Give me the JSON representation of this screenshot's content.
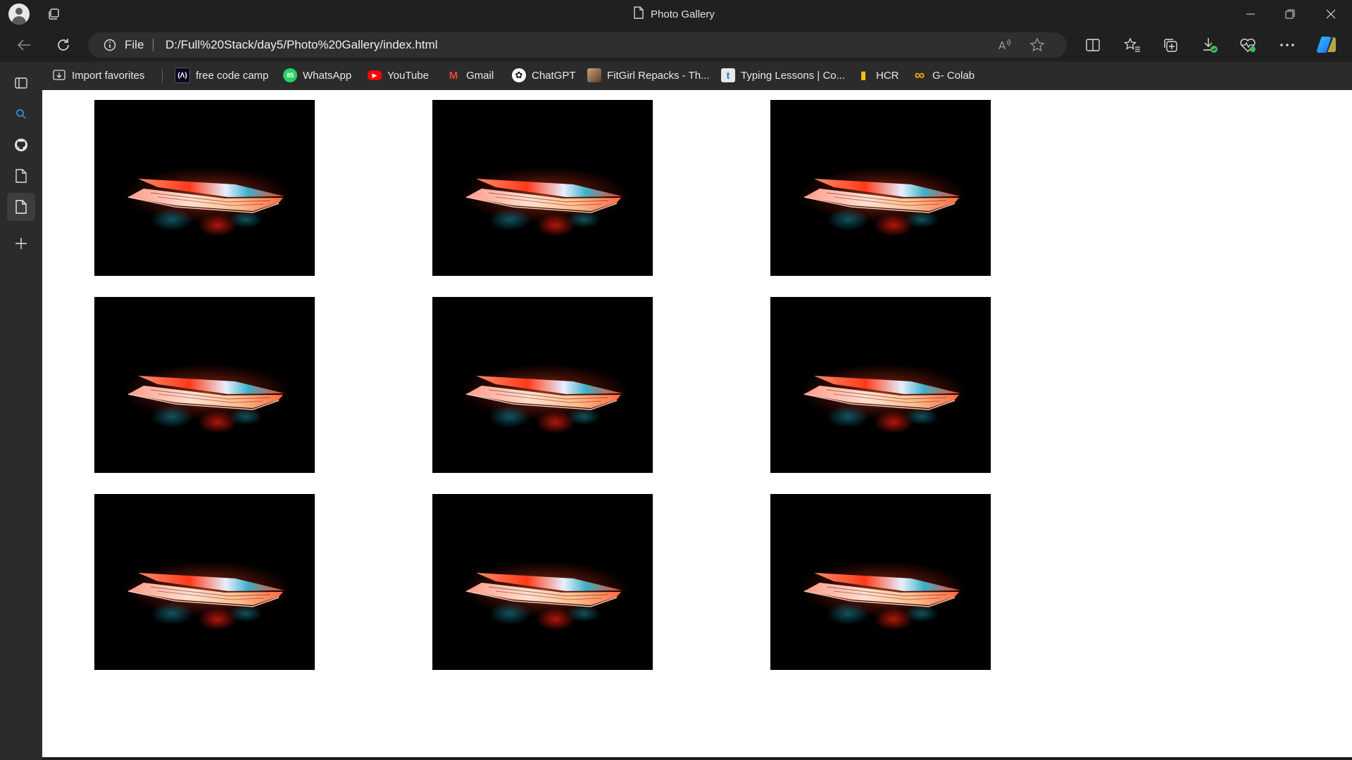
{
  "window": {
    "title": "Photo Gallery",
    "controls": [
      "minimize",
      "restore",
      "close"
    ]
  },
  "toolbar": {
    "back_icon": "back-arrow-icon",
    "refresh_icon": "refresh-icon",
    "address": {
      "scheme_label": "File",
      "url": "D:/Full%20Stack/day5/Photo%20Gallery/index.html"
    },
    "tools": [
      "read-aloud-icon",
      "favorite-star-icon",
      "split-screen-icon",
      "favorites-icon",
      "collections-icon",
      "downloads-icon",
      "browser-essentials-icon",
      "more-icon",
      "copilot-icon"
    ]
  },
  "favorites": [
    {
      "label": "Import favorites",
      "icon": "import-icon"
    },
    {
      "label": "free code camp",
      "icon": "freecodecamp-icon",
      "glyph": "(Λ)"
    },
    {
      "label": "WhatsApp",
      "icon": "whatsapp-icon",
      "glyph": "85"
    },
    {
      "label": "YouTube",
      "icon": "youtube-icon",
      "glyph": "▶"
    },
    {
      "label": "Gmail",
      "icon": "gmail-icon",
      "glyph": "M"
    },
    {
      "label": "ChatGPT",
      "icon": "chatgpt-icon",
      "glyph": "✿"
    },
    {
      "label": "FitGirl Repacks - Th...",
      "icon": "fitgirl-icon"
    },
    {
      "label": "Typing Lessons | Co...",
      "icon": "typing-icon",
      "glyph": "t"
    },
    {
      "label": "HCR",
      "icon": "hcr-icon",
      "glyph": "▮"
    },
    {
      "label": "G- Colab",
      "icon": "colab-icon",
      "glyph": "∞"
    }
  ],
  "sidebar": [
    "tabs-icon",
    "search-icon",
    "github-icon",
    "page-icon",
    "page-icon",
    "add-icon"
  ],
  "colors": {
    "chrome_dark": "#202020",
    "chrome": "#2b2b2b",
    "page_bg": "#ffffff",
    "photo_bg": "#000000",
    "laptop_glow": "#ff4a1c"
  },
  "gallery": {
    "photos": [
      {
        "alt": "laptop"
      },
      {
        "alt": "laptop"
      },
      {
        "alt": "laptop"
      },
      {
        "alt": "laptop"
      },
      {
        "alt": "laptop"
      },
      {
        "alt": "laptop"
      },
      {
        "alt": "laptop"
      },
      {
        "alt": "laptop"
      },
      {
        "alt": "laptop"
      }
    ]
  }
}
